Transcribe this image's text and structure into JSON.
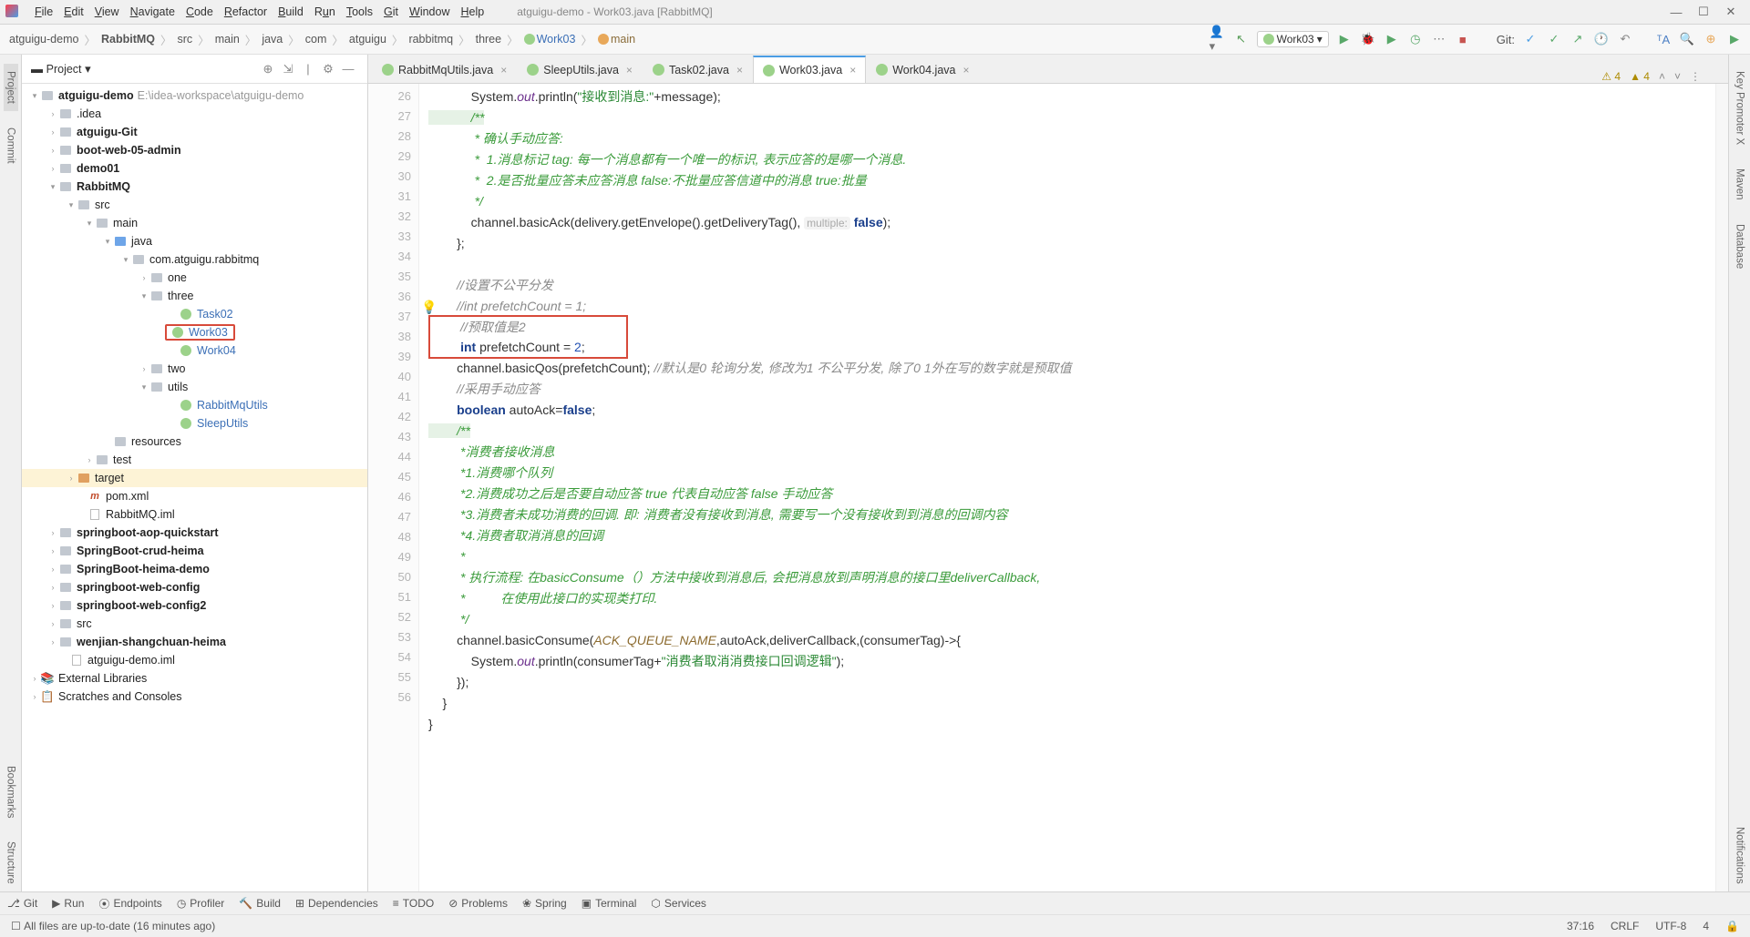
{
  "window": {
    "title": "atguigu-demo - Work03.java [RabbitMQ]"
  },
  "menu": {
    "file": "File",
    "edit": "Edit",
    "view": "View",
    "navigate": "Navigate",
    "code": "Code",
    "refactor": "Refactor",
    "build": "Build",
    "run": "Run",
    "tools": "Tools",
    "git": "Git",
    "window": "Window",
    "help": "Help"
  },
  "breadcrumbs": {
    "b0": "atguigu-demo",
    "b1": "RabbitMQ",
    "b2": "src",
    "b3": "main",
    "b4": "java",
    "b5": "com",
    "b6": "atguigu",
    "b7": "rabbitmq",
    "b8": "three",
    "b9": "Work03",
    "b10": "main"
  },
  "toolbar": {
    "run_config": "Work03",
    "git_label": "Git:"
  },
  "sidebar": {
    "title": "Project"
  },
  "tree": {
    "root": "atguigu-demo",
    "root_path": "E:\\idea-workspace\\atguigu-demo",
    "n_idea": ".idea",
    "n_atgit": "atguigu-Git",
    "n_boot05": "boot-web-05-admin",
    "n_demo01": "demo01",
    "n_rabbit": "RabbitMQ",
    "n_src": "src",
    "n_main": "main",
    "n_java": "java",
    "n_pkg": "com.atguigu.rabbitmq",
    "n_one": "one",
    "n_three": "three",
    "n_task02": "Task02",
    "n_work03": "Work03",
    "n_work04": "Work04",
    "n_two": "two",
    "n_utils": "utils",
    "n_rmqutils": "RabbitMqUtils",
    "n_sleep": "SleepUtils",
    "n_resources": "resources",
    "n_test": "test",
    "n_target": "target",
    "n_pom": "pom.xml",
    "n_iml": "RabbitMQ.iml",
    "n_sbaop": "springboot-aop-quickstart",
    "n_sbcrud": "SpringBoot-crud-heima",
    "n_sbheima": "SpringBoot-heima-demo",
    "n_sbweb": "springboot-web-config",
    "n_sbweb2": "springboot-web-config2",
    "n_srcd": "src",
    "n_wenjian": "wenjian-shangchuan-heima",
    "n_demoiml": "atguigu-demo.iml",
    "n_ext": "External Libraries",
    "n_scratch": "Scratches and Consoles"
  },
  "tabs": {
    "t0": "RabbitMqUtils.java",
    "t1": "SleepUtils.java",
    "t2": "Task02.java",
    "t3": "Work03.java",
    "t4": "Work04.java",
    "warn1": "4",
    "warn2": "4"
  },
  "gutter": {
    "start": 26,
    "end": 56
  },
  "code": {
    "l26a": "            System.",
    "l26b": "out",
    "l26c": ".println(",
    "l26d": "\"接收到消息:\"",
    "l26e": "+message);",
    "l27": "            /**",
    "l28": "             * 确认手动应答:",
    "l29": "             *  1.消息标记 tag: 每一个消息都有一个唯一的标识, 表示应答的是哪一个消息.",
    "l30": "             *  2.是否批量应答未应答消息 false:不批量应答信道中的消息 true:批量",
    "l31": "             */",
    "l32a": "            channel.basicAck(delivery.getEnvelope().getDeliveryTag(), ",
    "l32h": "multiple:",
    "l32b": " false",
    "l32c": ");",
    "l33": "        };",
    "l34": "",
    "l35": "        //设置不公平分发",
    "l36": "        //int prefetchCount = 1;",
    "l37": "        //预取值是2",
    "l38a": "        int",
    "l38b": " prefetchCount = ",
    "l38c": "2",
    "l38d": ";",
    "l39a": "        channel.basicQos(prefetchCount); ",
    "l39b": "//默认是0 轮询分发, 修改为1 不公平分发, 除了0 1外在写的数字就是预取值",
    "l40": "        //采用手动应答",
    "l41a": "        boolean",
    "l41b": " autoAck=",
    "l41c": "false",
    "l41d": ";",
    "l42": "        /**",
    "l43": "         *消费者接收消息",
    "l44": "         *1.消费哪个队列",
    "l45": "         *2.消费成功之后是否要自动应答 true 代表自动应答 false 手动应答",
    "l46": "         *3.消费者未成功消费的回调. 即: 消费者没有接收到消息, 需要写一个没有接收到到消息的回调内容",
    "l47": "         *4.消费者取消消息的回调",
    "l48": "         *",
    "l49": "         * 执行流程: 在basicConsume（）方法中接收到消息后, 会把消息放到声明消息的接口里deliverCallback,",
    "l50": "         *          在使用此接口的实现类打印.",
    "l51": "         */",
    "l52a": "        channel.basicConsume(",
    "l52b": "ACK_QUEUE_NAME",
    "l52c": ",autoAck,deliverCallback,(consumerTag)->{",
    "l53a": "            System.",
    "l53b": "out",
    "l53c": ".println(consumerTag+",
    "l53d": "\"消费者取消消费接口回调逻辑\"",
    "l53e": ");",
    "l54": "        });",
    "l55": "    }",
    "l56": "}"
  },
  "bottom": {
    "git": "Git",
    "run": "Run",
    "endpoints": "Endpoints",
    "profiler": "Profiler",
    "build": "Build",
    "deps": "Dependencies",
    "todo": "TODO",
    "problems": "Problems",
    "spring": "Spring",
    "terminal": "Terminal",
    "services": "Services"
  },
  "status": {
    "msg": "All files are up-to-date (16 minutes ago)",
    "pos": "37:16",
    "crlf": "CRLF",
    "enc": "UTF-8",
    "spaces": "4"
  },
  "lgutter": {
    "project": "Project",
    "commit": "Commit",
    "bookmarks": "Bookmarks",
    "structure": "Structure"
  },
  "rgutter": {
    "keyx": "Key Promoter X",
    "maven": "Maven",
    "database": "Database",
    "notif": "Notifications"
  }
}
